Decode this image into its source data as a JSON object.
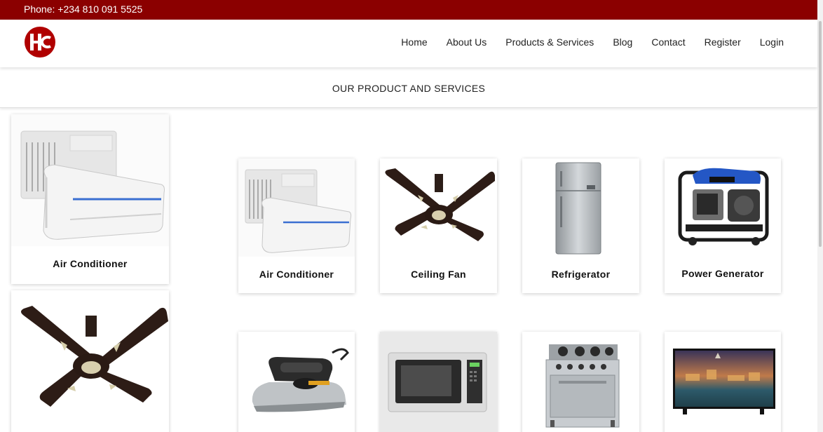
{
  "topbar": {
    "phone": "Phone: +234 810 091 5525"
  },
  "brand": {
    "logo_text": "HC",
    "color": "#b00000"
  },
  "nav": {
    "items": [
      {
        "label": "Home",
        "name": "home"
      },
      {
        "label": "About Us",
        "name": "about-us"
      },
      {
        "label": "Products & Services",
        "name": "products-services"
      },
      {
        "label": "Blog",
        "name": "blog"
      },
      {
        "label": "Contact",
        "name": "contact"
      },
      {
        "label": "Register",
        "name": "register"
      },
      {
        "label": "Login",
        "name": "login"
      }
    ]
  },
  "section": {
    "title": "OUR PRODUCT AND SERVICES"
  },
  "sidebar": {
    "cards": [
      {
        "label": "Air Conditioner",
        "icon": "air-conditioner-icon"
      },
      {
        "label": "",
        "icon": "ceiling-fan-icon"
      }
    ]
  },
  "products": {
    "row1": [
      {
        "label": "Air Conditioner",
        "icon": "air-conditioner-icon"
      },
      {
        "label": "Ceiling Fan",
        "icon": "ceiling-fan-icon"
      },
      {
        "label": "Refrigerator",
        "icon": "refrigerator-icon"
      },
      {
        "label": "Power Generator",
        "icon": "power-generator-icon"
      }
    ],
    "row2": [
      {
        "label": "",
        "icon": "iron-icon"
      },
      {
        "label": "",
        "icon": "microwave-icon"
      },
      {
        "label": "",
        "icon": "gas-cooker-icon"
      },
      {
        "label": "",
        "icon": "television-icon"
      }
    ]
  },
  "colors": {
    "topbar": "#8b0000",
    "accent": "#b00000"
  }
}
